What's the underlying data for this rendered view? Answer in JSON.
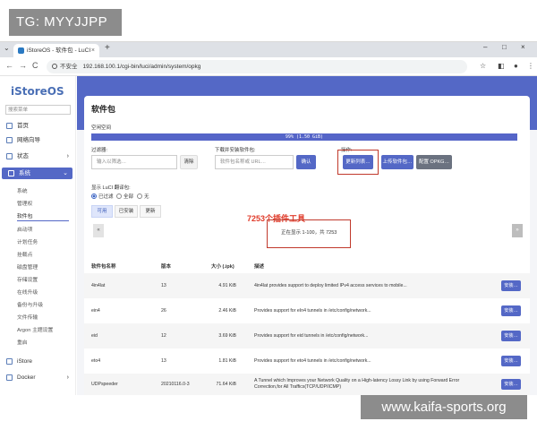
{
  "tag": "TG: MYYJJPP",
  "watermark": "www.kaifa-sports.org",
  "browser": {
    "tab_title": "iStoreOS - 软件包 - LuCI",
    "tab_close": "×",
    "new_tab": "+",
    "win_min": "–",
    "win_max": "□",
    "win_close": "×",
    "back": "←",
    "forward": "→",
    "reload": "C",
    "security": "不安全",
    "url": "192.168.100.1/cgi-bin/luci/admin/system/opkg"
  },
  "sidebar": {
    "logo": "iStoreOS",
    "search_placeholder": "搜索菜单",
    "items": [
      {
        "label": "首页"
      },
      {
        "label": "网络向导"
      },
      {
        "label": "状态"
      },
      {
        "label": "系统"
      },
      {
        "label": "iStore"
      },
      {
        "label": "Docker"
      }
    ],
    "sub_items": [
      "系统",
      "管理权",
      "软件包",
      "启动项",
      "计划任务",
      "挂载点",
      "磁盘管理",
      "存储设置",
      "在线升级",
      "备份与升级",
      "文件传输",
      "Argon 主题设置",
      "重启"
    ]
  },
  "page": {
    "title": "软件包",
    "disk_label": "空闲空间",
    "disk_text": "99% (1.50 GiB)",
    "filter_label": "过滤器:",
    "filter_placeholder": "输入以筛选…",
    "clear": "清除",
    "download_label": "下载并安装软件包:",
    "download_placeholder": "软件包名称或 URL…",
    "ok": "确认",
    "actions_label": "操作:",
    "update_lists": "更新列表…",
    "upload": "上传软件包…",
    "configure": "配置 OPKG…",
    "display_label": "显示 LuCI 翻译包:",
    "radio_filtered": "已过滤",
    "radio_all": "全部",
    "radio_none": "无",
    "tab_available": "可用",
    "tab_installed": "已安装",
    "tab_updates": "更新",
    "annotation": "7253个插件工具",
    "showing": "正在显示 1-100，共 7253",
    "prev": "«",
    "next": "»",
    "col_name": "软件包名称",
    "col_version": "版本",
    "col_size": "大小 (.ipk)",
    "col_desc": "描述",
    "install_label": "安装…",
    "rows": [
      {
        "name": "4in4lat",
        "version": "13",
        "size": "4.91 KiB",
        "desc": "4in4lat provides support to deploy limited IPv4 access services to mobile..."
      },
      {
        "name": "ein4",
        "version": "26",
        "size": "2.46 KiB",
        "desc": "Provides support for eIn4 tunnels in /etc/config/network..."
      },
      {
        "name": "eid",
        "version": "12",
        "size": "3.69 KiB",
        "desc": "Provides support for eid tunnels in /etc/config/network..."
      },
      {
        "name": "eto4",
        "version": "13",
        "size": "1.81 KiB",
        "desc": "Provides support for eto4 tunnels in /etc/config/network..."
      },
      {
        "name": "UDPspeeder",
        "version": "20210116.0-3",
        "size": "71.64 KiB",
        "desc": "A Tunnel which Improves your Network Quality on a High-latency Lossy Link by using Forward Error Correction,for All Traffics(TCP/UDP/ICMP)"
      }
    ]
  }
}
